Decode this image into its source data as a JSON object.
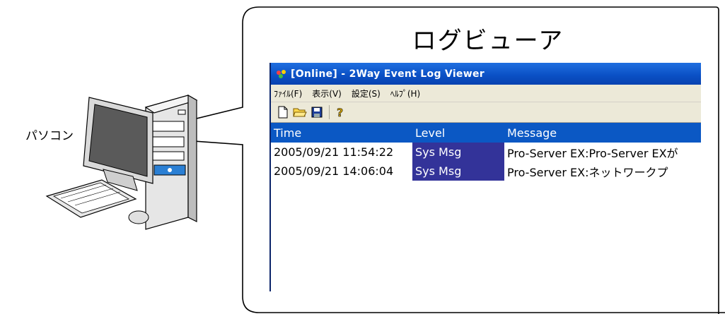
{
  "pc": {
    "label": "パソコン"
  },
  "callout": {
    "title": "ログビューア"
  },
  "window": {
    "title": "[Online] - 2Way Event Log Viewer",
    "menu": [
      "ﾌｧｲﾙ(F)",
      "表示(V)",
      "設定(S)",
      "ﾍﾙﾌﾟ(H)"
    ],
    "toolbar_icons": [
      "new-file-icon",
      "open-folder-icon",
      "save-icon",
      "help-icon"
    ],
    "columns": [
      "Time",
      "Level",
      "Message"
    ],
    "rows": [
      {
        "time": "2005/09/21 11:54:22",
        "level": "Sys Msg",
        "message": "Pro-Server EX:Pro-Server EXが"
      },
      {
        "time": "2005/09/21 14:06:04",
        "level": "Sys Msg",
        "message": "Pro-Server EX:ネットワークプ"
      }
    ]
  },
  "colors": {
    "titlebar": "#0a4fc4",
    "header": "#0b58c4",
    "level_highlight": "#333399",
    "chrome": "#ece9d8"
  }
}
